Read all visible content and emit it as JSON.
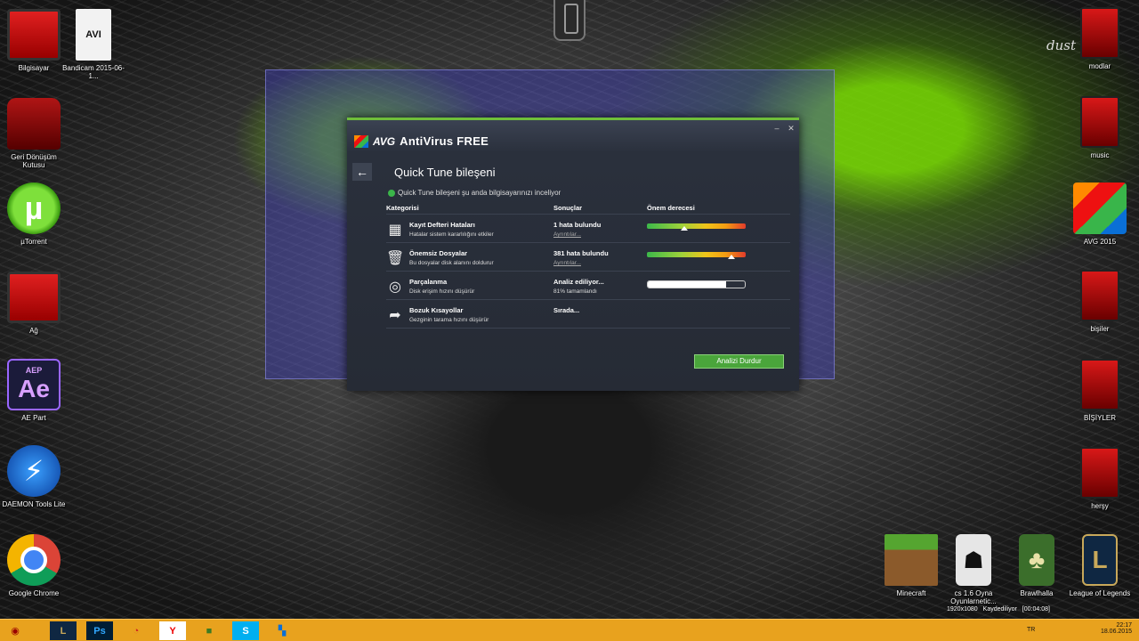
{
  "desktop": {
    "left_icons": [
      {
        "icon": "computer-icon",
        "label": "Bilgisayar"
      },
      {
        "icon": "video-file-icon",
        "label": "Bandicam 2015-06-1..."
      },
      {
        "icon": "recycle-bin-icon",
        "label": "Geri Dönüşüm Kutusu"
      },
      {
        "icon": "utorrent-icon",
        "label": "µTorrent"
      },
      {
        "icon": "network-icon",
        "label": "Ağ"
      },
      {
        "icon": "after-effects-icon",
        "label": "AE Part"
      },
      {
        "icon": "daemon-tools-icon",
        "label": "DAEMON Tools Lite"
      },
      {
        "icon": "chrome-icon",
        "label": "Google Chrome"
      }
    ],
    "right_icons": [
      {
        "icon": "folder-icon",
        "label": "modlar"
      },
      {
        "icon": "folder-icon",
        "label": "music"
      },
      {
        "icon": "avg-icon",
        "label": "AVG 2015"
      },
      {
        "icon": "folder-icon",
        "label": "bişiler"
      },
      {
        "icon": "folder-icon",
        "label": "BİŞİYLER"
      },
      {
        "icon": "folder-icon",
        "label": "herşy"
      }
    ],
    "bottom_icons": [
      {
        "icon": "minecraft-icon",
        "label": "Minecraft"
      },
      {
        "icon": "counter-strike-icon",
        "label": "cs 1.6 Oyna Oyunlarnetic..."
      },
      {
        "icon": "brawlhalla-icon",
        "label": "Brawlhalla"
      },
      {
        "icon": "league-of-legends-icon",
        "label": "League of Legends"
      }
    ],
    "video_badge": "AVI",
    "ae_badge_top": "AEP",
    "ae_badge_main": "Ae",
    "signature": "dust"
  },
  "avg": {
    "app_logo": "AVG",
    "app_name": "AntiVirus FREE",
    "back_arrow": "←",
    "page_title": "Quick Tune bileşeni",
    "status_text": "Quick Tune bileşeni şu anda bilgisayarınızı inceliyor",
    "columns": [
      "Kategorisi",
      "Sonuçlar",
      "Önem derecesi"
    ],
    "rows": [
      {
        "icon": "registry-icon",
        "glyph": "▦",
        "title": "Kayıt Defteri Hataları",
        "subtitle": "Hatalar sistem kararlılığını etkiler",
        "result": "1 hata bulundu",
        "detail": "Ayrıntılar...",
        "severity": 0.38,
        "kind": "severity"
      },
      {
        "icon": "trash-icon",
        "glyph": "🗑",
        "title": "Önemsiz Dosyalar",
        "subtitle": "Bu dosyalar disk alanını doldurur",
        "result": "381 hata bulundu",
        "detail": "Ayrıntılar...",
        "severity": 0.86,
        "kind": "severity"
      },
      {
        "icon": "defrag-icon",
        "glyph": "◎",
        "title": "Parçalanma",
        "subtitle": "Disk erişim hızını düşürür",
        "result": "Analiz ediliyor...",
        "detail": "81% tamamlandı",
        "progress": 0.81,
        "kind": "progress"
      },
      {
        "icon": "shortcut-icon",
        "glyph": "➦",
        "title": "Bozuk Kısayollar",
        "subtitle": "Gezginin tarama hızını düşürür",
        "result": "Sırada...",
        "detail": "",
        "kind": "none"
      }
    ],
    "stop_button": "Analizi Durdur",
    "colors": {
      "accent": "#4aa53b",
      "window_bg": "#262b35"
    }
  },
  "taskbar": {
    "items": [
      {
        "icon": "start-icon",
        "glyph": "◉"
      },
      {
        "icon": "league-of-legends-icon",
        "glyph": "L"
      },
      {
        "icon": "photoshop-icon",
        "glyph": "Ps"
      },
      {
        "icon": "swirl-app-icon",
        "glyph": "◔"
      },
      {
        "icon": "yandex-icon",
        "glyph": "Y"
      },
      {
        "icon": "minecraft-icon",
        "glyph": "■"
      },
      {
        "icon": "skype-icon",
        "glyph": "S"
      },
      {
        "icon": "avg-icon",
        "glyph": "▚"
      }
    ],
    "lang": "TR",
    "time": "22:17",
    "date": "18.06.2015",
    "osd_resolution": "1920x1080",
    "osd_status": "Kaydediliyor",
    "osd_timer": "[00:04:08]"
  }
}
